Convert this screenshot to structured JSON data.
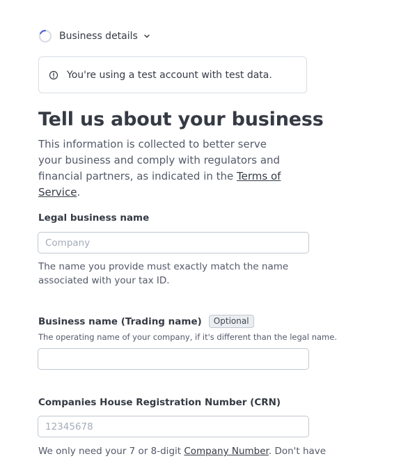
{
  "header": {
    "step_label": "Business details"
  },
  "notice": {
    "text": "You're using a test account with test data."
  },
  "main": {
    "title": "Tell us about your business",
    "intro_text": "This information is collected to better serve your business and comply with regulators and financial partners, as indicated in the ",
    "intro_link": "Terms of Service",
    "intro_end": "."
  },
  "fields": {
    "legal_name": {
      "label": "Legal business name",
      "placeholder": "Company",
      "value": "",
      "help": "The name you provide must exactly match the name associated with your tax ID."
    },
    "trading_name": {
      "label": "Business name (Trading name)",
      "badge": "Optional",
      "help": "The operating name of your company, if it's different than the legal name.",
      "placeholder": "",
      "value": ""
    },
    "crn": {
      "label": "Companies House Registration Number (CRN)",
      "placeholder": "12345678",
      "value": "",
      "help_prefix": "We only need your 7 or 8-digit ",
      "help_link": "Company Number",
      "help_suffix": ". Don't have"
    }
  },
  "colors": {
    "text": "#353a44",
    "muted": "#545969",
    "border": "#c0c8d2",
    "progress_accent": "#5469d4"
  },
  "icons": {
    "progress": "progress-ring-icon",
    "chevron": "chevron-down-icon",
    "info": "info-icon"
  }
}
